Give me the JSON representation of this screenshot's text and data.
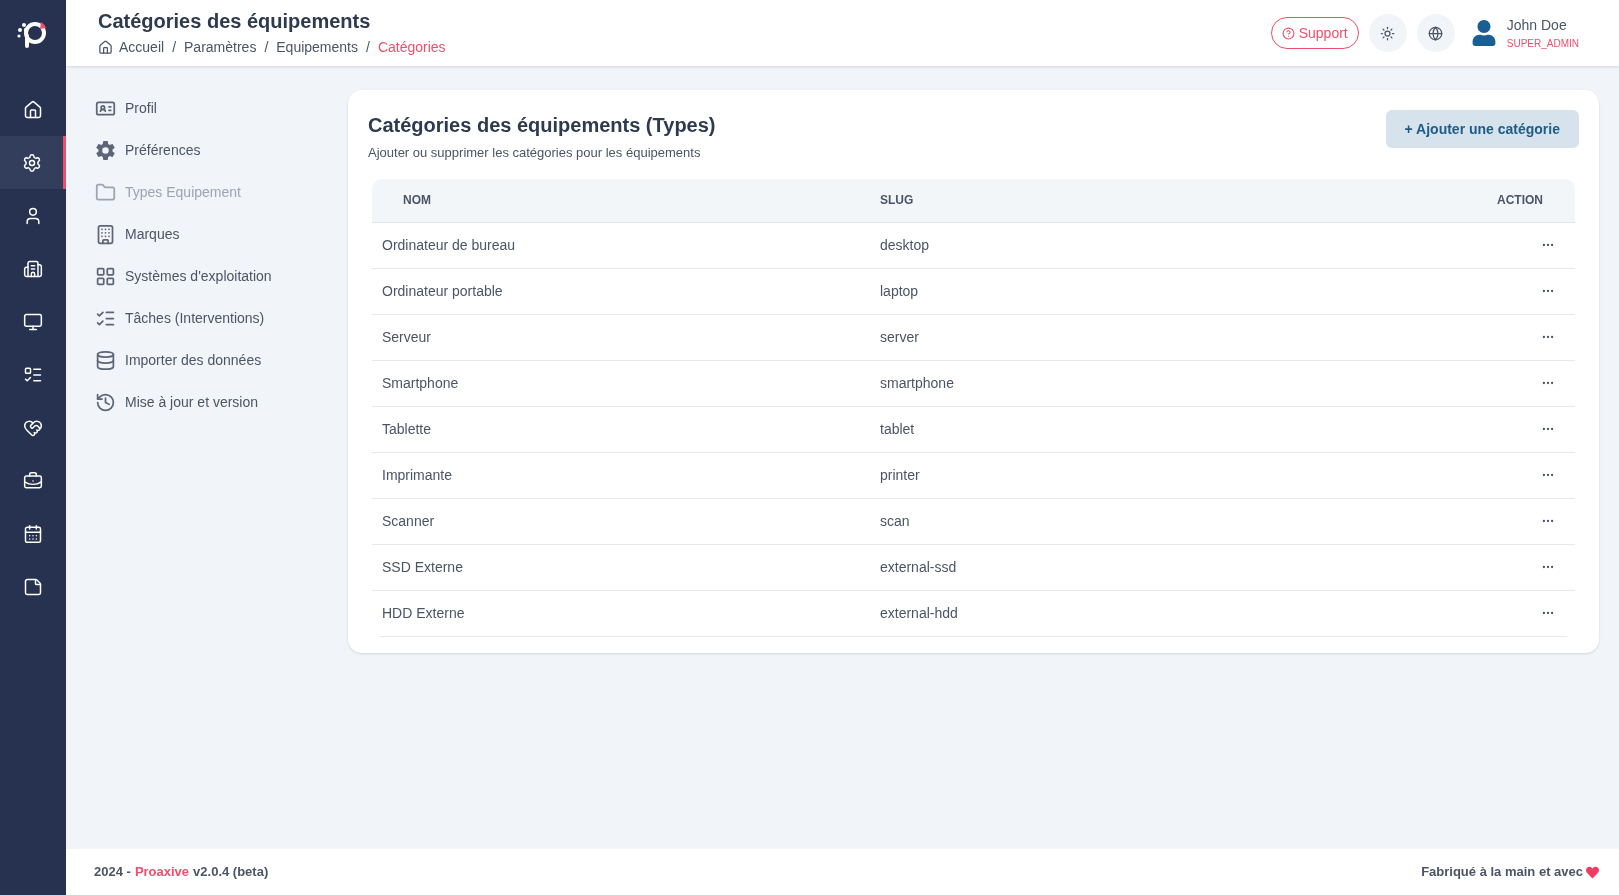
{
  "nav": [
    {
      "kind": "home",
      "selected": false
    },
    {
      "kind": "settings",
      "selected": true
    },
    {
      "kind": "user",
      "selected": false
    },
    {
      "kind": "building",
      "selected": false
    },
    {
      "kind": "monitor",
      "selected": false
    },
    {
      "kind": "list",
      "selected": false
    },
    {
      "kind": "handshake",
      "selected": false
    },
    {
      "kind": "briefcase",
      "selected": false
    },
    {
      "kind": "calendar",
      "selected": false
    },
    {
      "kind": "note",
      "selected": false
    }
  ],
  "header": {
    "title": "Catégories des équipements",
    "breadcrumb": [
      {
        "label": "Accueil",
        "selected": false
      },
      {
        "label": "Paramètres",
        "selected": false
      },
      {
        "label": "Equipements",
        "selected": false
      },
      {
        "label": "Catégories",
        "selected": true
      }
    ],
    "separator": "/",
    "support": "Support",
    "user": {
      "name": "John Doe",
      "role": "SUPER_ADMIN"
    }
  },
  "settings_menu": [
    {
      "kind": "profile",
      "label": "Profil",
      "selected": false
    },
    {
      "kind": "preferences",
      "label": "Préférences",
      "selected": false
    },
    {
      "kind": "types",
      "label": "Types Equipement",
      "selected": true
    },
    {
      "kind": "brands",
      "label": "Marques",
      "selected": false
    },
    {
      "kind": "os",
      "label": "Systèmes d'exploitation",
      "selected": false
    },
    {
      "kind": "tasks",
      "label": "Tâches (Interventions)",
      "selected": false
    },
    {
      "kind": "import",
      "label": "Importer des données",
      "selected": false
    },
    {
      "kind": "update",
      "label": "Mise à jour et version",
      "selected": false
    }
  ],
  "card": {
    "title": "Catégories des équipements (Types)",
    "subtitle": "Ajouter ou supprimer les catégories pour les équipements",
    "add_button": "+ Ajouter une catégorie"
  },
  "table": {
    "columns": [
      "NOM",
      "SLUG",
      "ACTION"
    ],
    "rows": [
      {
        "name": "Ordinateur de bureau",
        "slug": "desktop"
      },
      {
        "name": "Ordinateur portable",
        "slug": "laptop"
      },
      {
        "name": "Serveur",
        "slug": "server"
      },
      {
        "name": "Smartphone",
        "slug": "smartphone"
      },
      {
        "name": "Tablette",
        "slug": "tablet"
      },
      {
        "name": "Imprimante",
        "slug": "printer"
      },
      {
        "name": "Scanner",
        "slug": "scan"
      },
      {
        "name": "SSD Externe",
        "slug": "external-ssd"
      },
      {
        "name": "HDD Externe",
        "slug": "external-hdd"
      }
    ]
  },
  "footer": {
    "year": "2024 -",
    "brand": "Proaxive",
    "version": "v2.0.4 (beta)",
    "made": "Fabriqué à la main et avec"
  }
}
